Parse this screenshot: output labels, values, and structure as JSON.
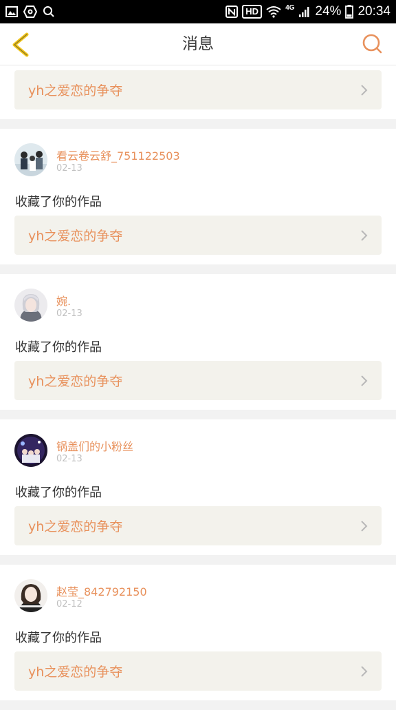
{
  "status_bar": {
    "hd": "HD",
    "network": "4G",
    "battery": "24%",
    "time": "20:34"
  },
  "header": {
    "title": "消息"
  },
  "colors": {
    "accent": "#e8915c",
    "back_arrow": "#f0c419",
    "link_bg": "#f3f2ec"
  },
  "top_card": {
    "link": "yh之爱恋的争夺"
  },
  "messages": [
    {
      "user": "看云卷云舒_751122503",
      "date": "02-13",
      "action": "收藏了你的作品",
      "link": "yh之爱恋的争夺"
    },
    {
      "user": "婉.",
      "date": "02-13",
      "action": "收藏了你的作品",
      "link": "yh之爱恋的争夺"
    },
    {
      "user": "锅盖们的小粉丝",
      "date": "02-13",
      "action": "收藏了你的作品",
      "link": "yh之爱恋的争夺"
    },
    {
      "user": "赵莹_842792150",
      "date": "02-12",
      "action": "收藏了你的作品",
      "link": "yh之爱恋的争夺"
    }
  ]
}
